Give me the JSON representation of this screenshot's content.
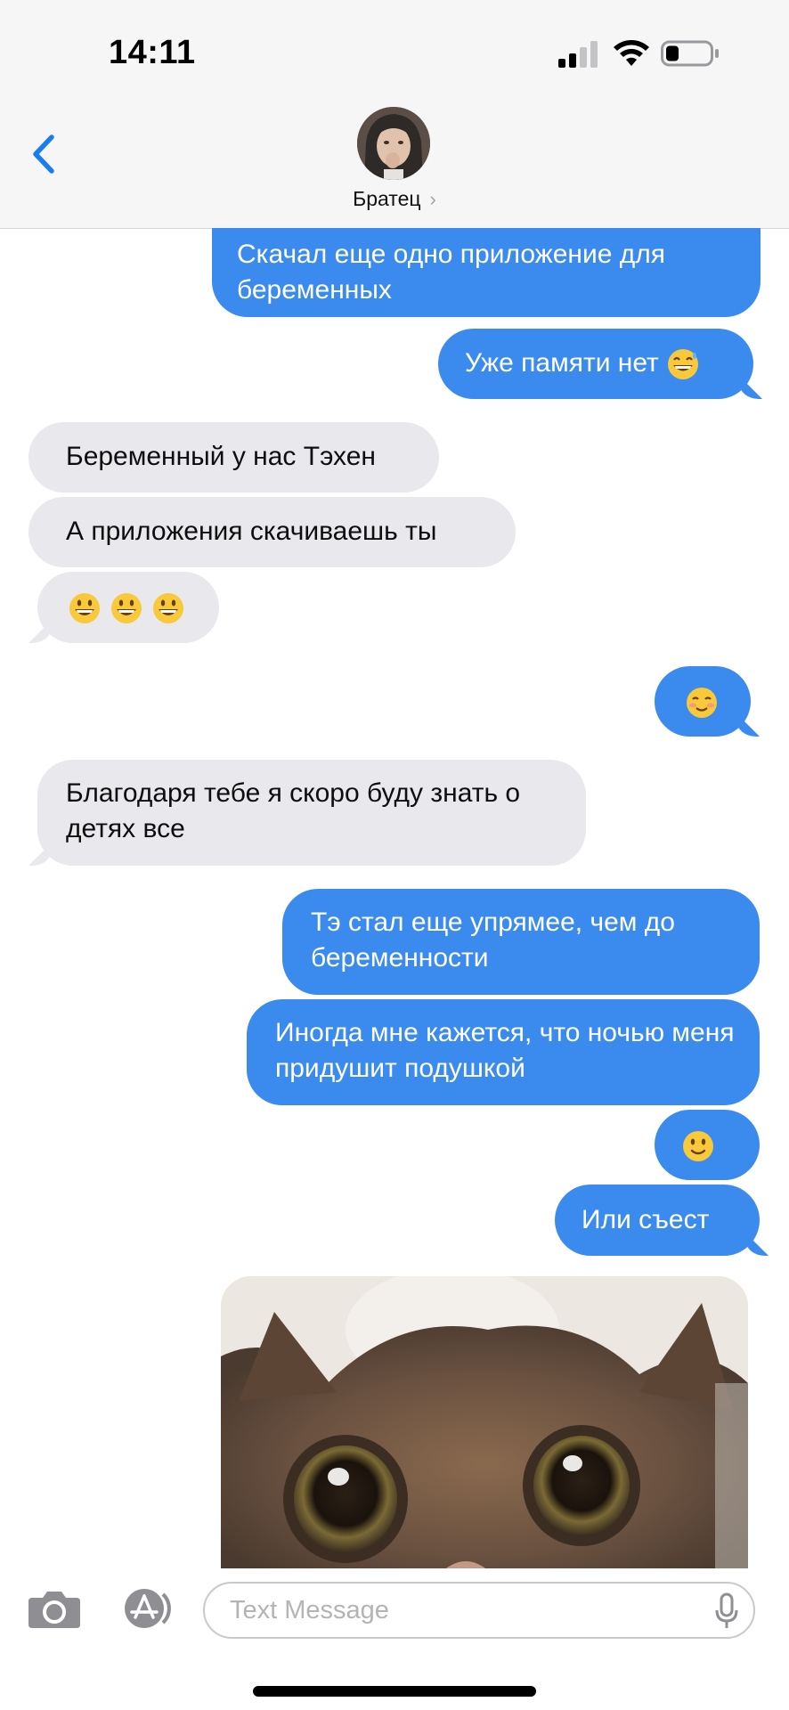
{
  "status_bar": {
    "time": "14:11",
    "signal_icon": "cellular-signal-icon",
    "wifi_icon": "wifi-icon",
    "battery_icon": "battery-low-icon",
    "battery_level": 0.25
  },
  "header": {
    "back_icon": "chevron-left-icon",
    "contact_name": "Братец",
    "contact_chevron": "›",
    "accent_color": "#1a7cf2"
  },
  "messages": [
    {
      "dir": "out",
      "text": "Скачал еще одно приложение для беременных"
    },
    {
      "dir": "out",
      "text": "Уже памяти нет",
      "emoji": "grinning-sweat-emoji"
    },
    {
      "dir": "in",
      "text": "Беременный у нас Тэхен"
    },
    {
      "dir": "in",
      "text": "А приложения скачиваешь ты"
    },
    {
      "dir": "in",
      "emoji": "grinning-emoji x3"
    },
    {
      "dir": "out",
      "emoji": "smiling-blush-emoji"
    },
    {
      "dir": "in",
      "text": "Благодаря тебе я скоро буду знать о детях все"
    },
    {
      "dir": "out",
      "text": "Тэ стал еще упрямее, чем до беременности"
    },
    {
      "dir": "out",
      "text": "Иногда мне кажется, что ночью меня придушит подушкой"
    },
    {
      "dir": "out",
      "emoji": "slight-smile-emoji"
    },
    {
      "dir": "out",
      "text": "Или съест"
    },
    {
      "dir": "out",
      "image": "kitten-photo"
    }
  ],
  "input_bar": {
    "placeholder": "Text Message",
    "camera_icon": "camera-icon",
    "appstore_icon": "app-store-icon",
    "mic_icon": "microphone-icon"
  },
  "colors": {
    "outgoing_bubble": "#3b8bef",
    "incoming_bubble": "#e9e8ec"
  }
}
